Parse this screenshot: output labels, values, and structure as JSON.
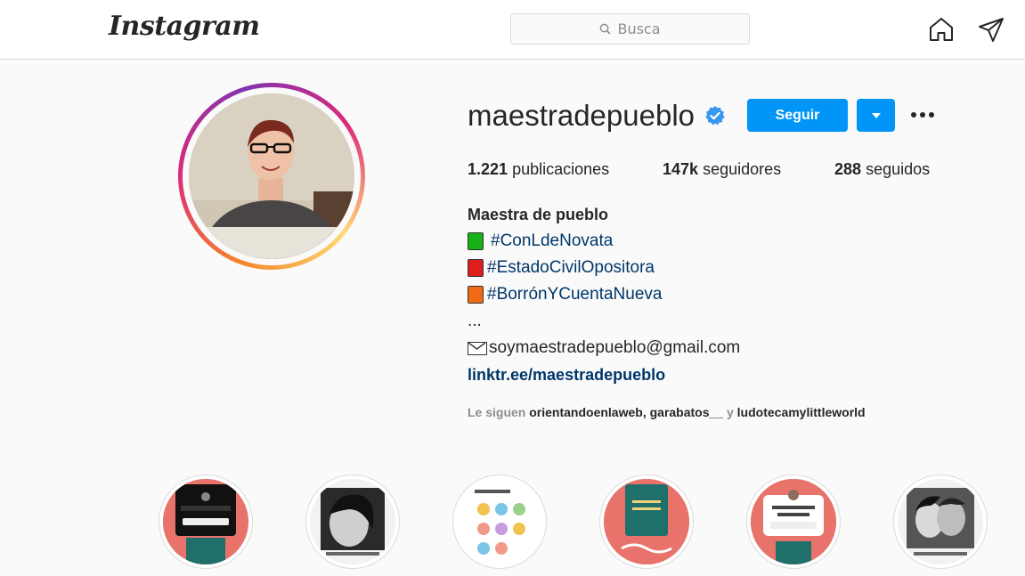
{
  "nav": {
    "logo": "Instagram",
    "search_placeholder": "Busca"
  },
  "profile": {
    "username": "maestradepueblo",
    "follow_label": "Seguir",
    "stats": {
      "posts_count": "1.221",
      "posts_label": "publicaciones",
      "followers_count": "147k",
      "followers_label": "seguidores",
      "following_count": "288",
      "following_label": "seguidos"
    },
    "bio": {
      "name": "Maestra de pueblo",
      "hashtags": [
        "#ConLdeNovata",
        "#EstadoCivilOpositora",
        "#BorrónYCuentaNueva"
      ],
      "ellipsis": "...",
      "email": "soymaestradepueblo@gmail.com",
      "link": "linktr.ee/maestradepueblo"
    },
    "followed_by": {
      "prefix": "Le siguen",
      "user1": "orientandoenlaweb",
      "sep": ",",
      "user2": "garabatos__",
      "conj": "y",
      "user3": "ludotecamylittleworld"
    }
  },
  "colors": {
    "accent": "#0095f6",
    "link": "#00376b",
    "muted": "#8e8e8e"
  }
}
